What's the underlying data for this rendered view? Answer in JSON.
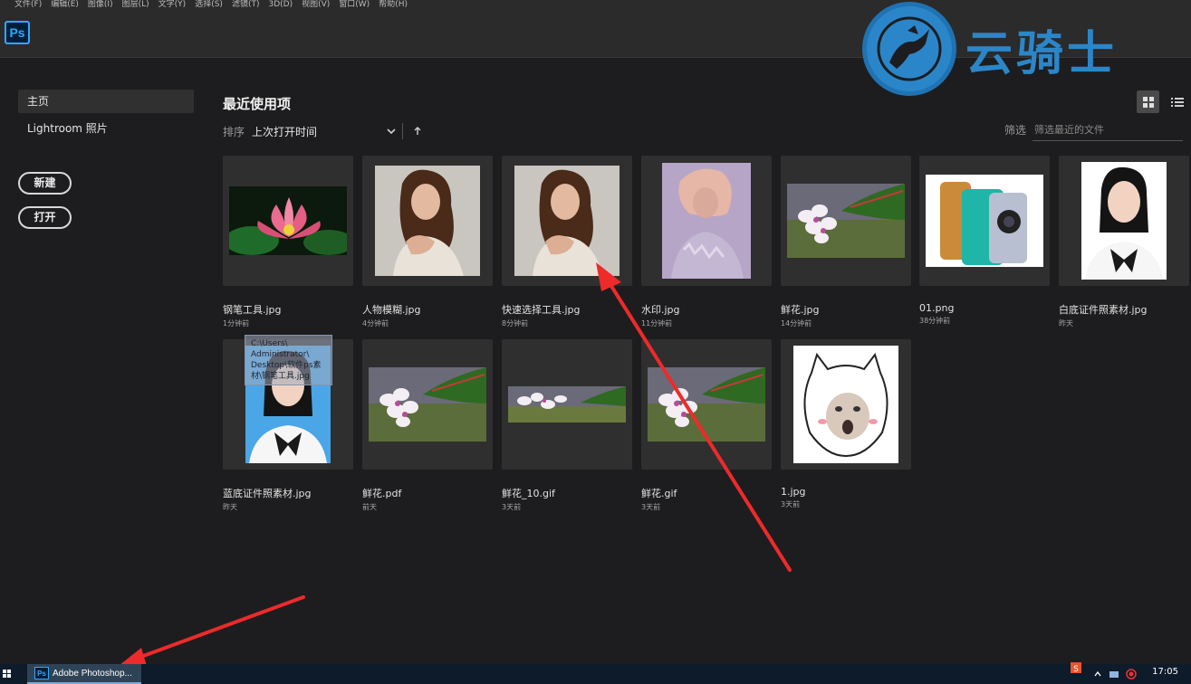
{
  "menu": [
    "文件(F)",
    "编辑(E)",
    "图像(I)",
    "图层(L)",
    "文字(Y)",
    "选择(S)",
    "滤镜(T)",
    "3D(D)",
    "视图(V)",
    "窗口(W)",
    "帮助(H)"
  ],
  "app": {
    "logo_text": "Ps",
    "accent": "#31a8ff"
  },
  "watermark": {
    "text": "云骑士",
    "color": "#2b86c9"
  },
  "sidebar": {
    "items": [
      {
        "label": "主页",
        "active": true
      },
      {
        "label": "Lightroom 照片",
        "active": false
      }
    ],
    "new_label": "新建",
    "open_label": "打开"
  },
  "main": {
    "title": "最近使用项",
    "sort_label": "排序",
    "sort_value": "上次打开时间",
    "filter_label": "筛选",
    "filter_placeholder": "筛选最近的文件"
  },
  "files": [
    {
      "name": "钢笔工具.jpg",
      "time": "1分钟前",
      "kind": "lotus"
    },
    {
      "name": "人物模糊.jpg",
      "time": "4分钟前",
      "kind": "portrait"
    },
    {
      "name": "快速选择工具.jpg",
      "time": "8分钟前",
      "kind": "portrait"
    },
    {
      "name": "水印.jpg",
      "time": "11分钟前",
      "kind": "watermark-portrait"
    },
    {
      "name": "鲜花.jpg",
      "time": "14分钟前",
      "kind": "flower"
    },
    {
      "name": "01.png",
      "time": "38分钟前",
      "kind": "phones"
    },
    {
      "name": "白底证件照素材.jpg",
      "time": "昨天",
      "kind": "id-white"
    },
    {
      "name": "蓝底证件照素材.jpg",
      "time": "昨天",
      "kind": "id-blue"
    },
    {
      "name": "鲜花.pdf",
      "time": "前天",
      "kind": "flower"
    },
    {
      "name": "鲜花_10.gif",
      "time": "3天前",
      "kind": "flower-wide"
    },
    {
      "name": "鲜花.gif",
      "time": "3天前",
      "kind": "flower"
    },
    {
      "name": "1.jpg",
      "time": "3天前",
      "kind": "meme"
    }
  ],
  "tooltip": {
    "lines": [
      "C:\\Users\\",
      "Administrator\\",
      "Desktop\\软件ps素",
      "材\\钢笔工具.jpg"
    ]
  },
  "taskbar": {
    "app_label": "Adobe Photoshop...",
    "clock": "17:05"
  }
}
